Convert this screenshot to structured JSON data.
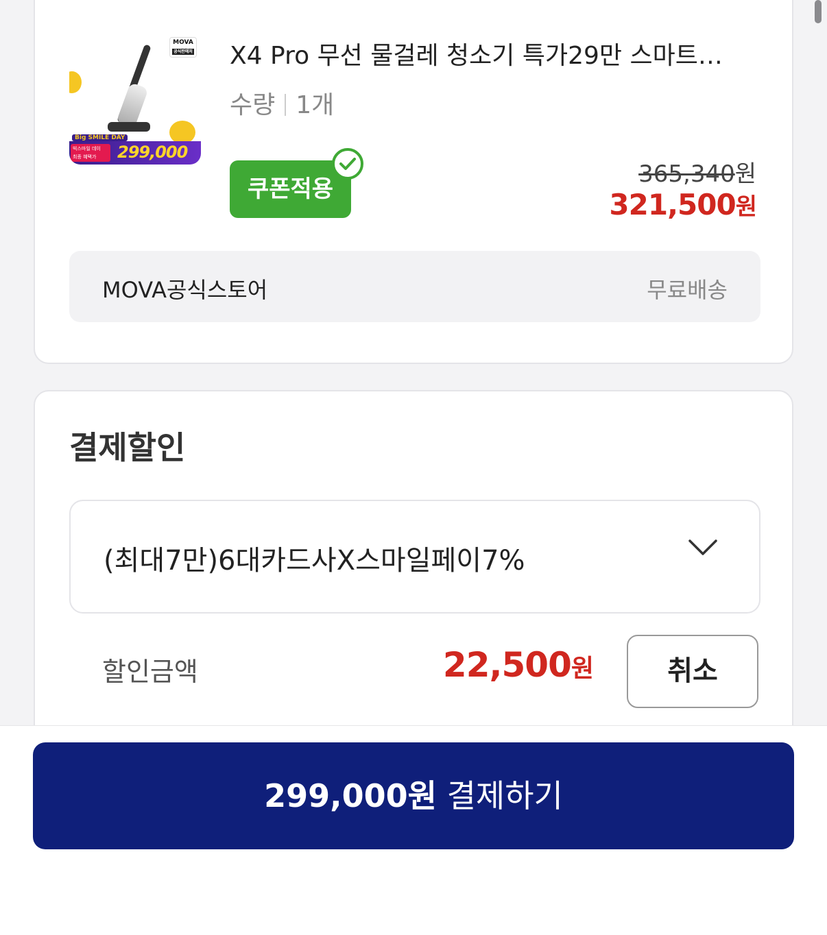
{
  "product": {
    "title": "X4 Pro 무선 물걸레 청소기 특가29만 스마트…",
    "qty_label": "수량",
    "qty_value": "1개",
    "coupon_label": "쿠폰적용",
    "original_price": "365,340",
    "sale_price": "321,500",
    "currency": "원",
    "thumb_price": "299,000",
    "thumb_logo": "MOVA",
    "thumb_logo_sub": "공식판매처",
    "thumb_tag_line1": "빅스마일 데이",
    "thumb_tag_line2": "최종 혜택가",
    "thumb_smile": "Big SMILE DAY"
  },
  "store": {
    "name": "MOVA공식스토어",
    "shipping": "무료배송"
  },
  "discount": {
    "section_title": "결제할인",
    "selected_option": "(최대7만)6대카드사X스마일페이7%",
    "amount_label": "할인금액",
    "amount": "22,500",
    "currency": "원",
    "cancel_label": "취소"
  },
  "checkout": {
    "amount": "299,000원",
    "action": "결제하기"
  },
  "colors": {
    "coupon_green": "#3fa935",
    "price_red": "#d0271f",
    "pay_navy": "#0f1f7a"
  }
}
